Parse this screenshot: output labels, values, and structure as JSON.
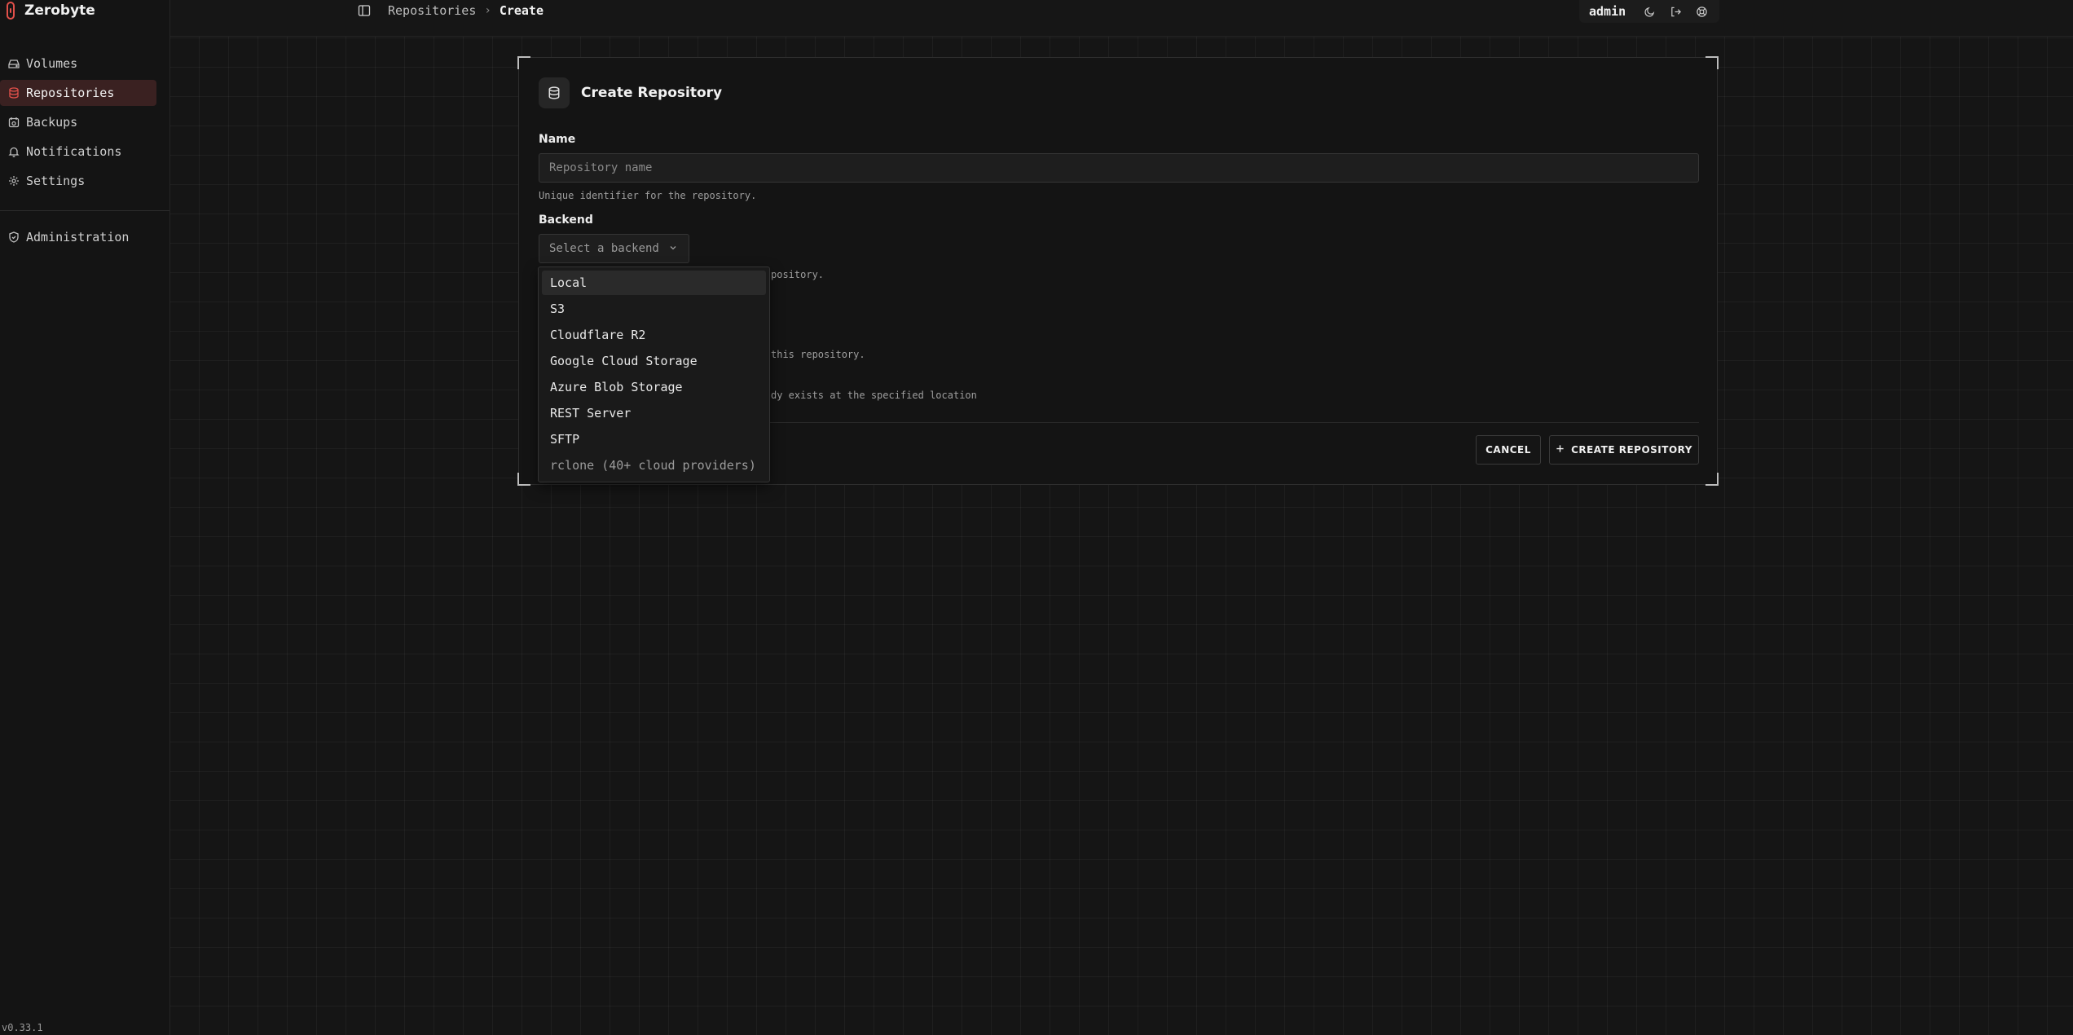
{
  "app": {
    "name": "Zerobyte",
    "version": "v0.33.1",
    "accent": "#e2504a"
  },
  "sidebar": {
    "items": [
      {
        "label": "Volumes",
        "icon": "hard-drive-icon"
      },
      {
        "label": "Repositories",
        "icon": "database-icon",
        "active": true
      },
      {
        "label": "Backups",
        "icon": "calendar-icon"
      },
      {
        "label": "Notifications",
        "icon": "bell-icon"
      },
      {
        "label": "Settings",
        "icon": "gear-icon"
      }
    ],
    "admin_item": {
      "label": "Administration",
      "icon": "shield-icon"
    }
  },
  "header": {
    "breadcrumb": [
      "Repositories",
      "Create"
    ],
    "user": "admin"
  },
  "form": {
    "title": "Create Repository",
    "name_label": "Name",
    "name_placeholder": "Repository name",
    "name_value": "",
    "name_hint": "Unique identifier for the repository.",
    "backend_label": "Backend",
    "backend_placeholder": "Select a backend",
    "partial_hints": [
      "pository.",
      "this repository.",
      "dy exists at the specified location"
    ],
    "cancel_label": "CANCEL",
    "create_label": "CREATE REPOSITORY"
  },
  "backend_options": [
    "Local",
    "S3",
    "Cloudflare R2",
    "Google Cloud Storage",
    "Azure Blob Storage",
    "REST Server",
    "SFTP",
    "rclone (40+ cloud providers)"
  ]
}
